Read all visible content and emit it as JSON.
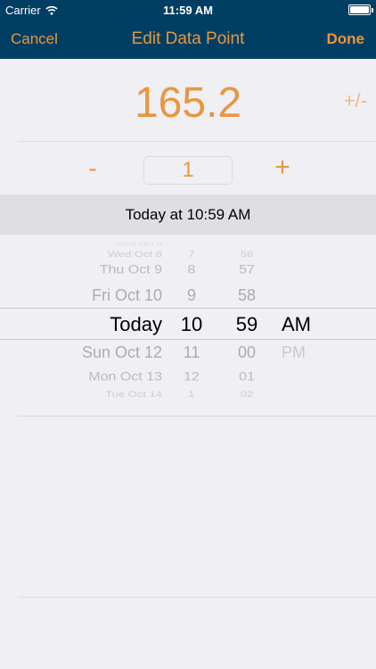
{
  "status": {
    "carrier": "Carrier",
    "time": "11:59 AM"
  },
  "nav": {
    "cancel": "Cancel",
    "title": "Edit Data Point",
    "done": "Done"
  },
  "value": {
    "display": "165.2",
    "sign_toggle": "+/-"
  },
  "stepper": {
    "minus": "-",
    "step": "1",
    "plus": "+"
  },
  "date_summary": "Today at 10:59 AM",
  "picker": {
    "dates": [
      "Wed Oct 8",
      "Thu Oct 9",
      "Fri Oct 10",
      "Today",
      "Sun Oct 12",
      "Mon Oct 13",
      "Tue Oct 14"
    ],
    "hours": [
      "7",
      "8",
      "9",
      "10",
      "11",
      "12",
      "1"
    ],
    "minutes": [
      "56",
      "57",
      "58",
      "59",
      "00",
      "01",
      "02"
    ],
    "ampm": [
      "AM",
      "PM"
    ],
    "selected": {
      "date": "Today",
      "hour": "10",
      "minute": "59",
      "ampm": "AM"
    }
  },
  "colors": {
    "accent": "#e8973f",
    "navbar": "#003f63",
    "background": "#efeff4"
  }
}
